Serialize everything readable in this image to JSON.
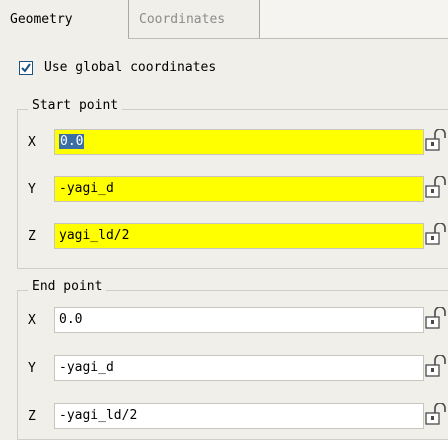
{
  "tabs": [
    {
      "label": "Geometry",
      "active": true
    },
    {
      "label": "Coordinates",
      "active": false
    }
  ],
  "global_coords": {
    "label": "Use global coordinates",
    "checked": true
  },
  "start_point": {
    "title": "Start point",
    "rows": [
      {
        "axis": "X",
        "value": "0.0",
        "highlight": "#ffff00"
      },
      {
        "axis": "Y",
        "value": "-yagi_d",
        "highlight": "#ffff00"
      },
      {
        "axis": "Z",
        "value": "yagi_ld/2",
        "highlight": "#ffff00"
      }
    ]
  },
  "end_point": {
    "title": "End point",
    "rows": [
      {
        "axis": "X",
        "value": "0.0"
      },
      {
        "axis": "Y",
        "value": "-yagi_d"
      },
      {
        "axis": "Z",
        "value": "-yagi_ld/2"
      }
    ]
  },
  "icons": {
    "lock": "unlocked-padlock-icon"
  },
  "colors": {
    "highlight": "#ffff00",
    "selection": "#3a6ea5",
    "background": "#f0efea"
  }
}
